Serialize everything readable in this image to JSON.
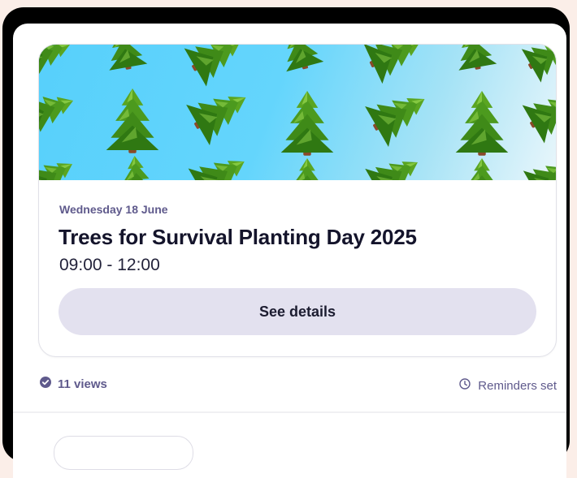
{
  "event": {
    "date": "Wednesday 18 June",
    "title": "Trees for Survival Planting Day 2025",
    "time": "09:00 - 12:00",
    "details_button": "See details",
    "banner_icon": "tree-emoji-pattern"
  },
  "footer": {
    "views": "11 views",
    "views_icon": "check-circle-icon",
    "reminders": "Reminders set",
    "reminders_icon": "clock-icon"
  },
  "colors": {
    "accent": "#5f5a8c",
    "button_bg": "#e3e1ef",
    "banner_start": "#57d0fb",
    "banner_end": "#e9f6fb"
  }
}
